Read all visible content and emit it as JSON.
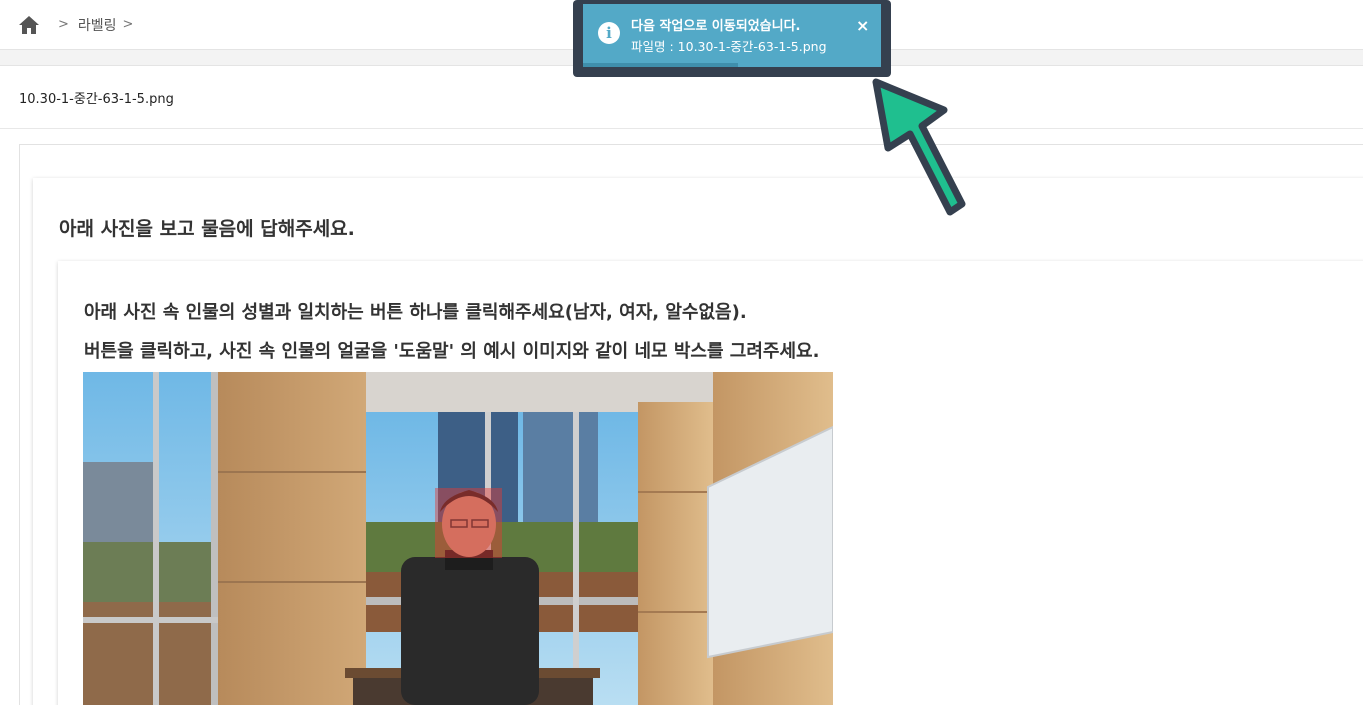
{
  "breadcrumb": {
    "home_icon": "home-icon",
    "separator": ">",
    "item": "라벨링",
    "trailing_separator": ">"
  },
  "file": {
    "name": "10.30-1-중간-63-1-5.png"
  },
  "question": {
    "title": "아래 사진을 보고 물음에 답해주세요.",
    "instruction_1": "아래 사진 속 인물의 성별과 일치하는 버튼 하나를 클릭해주세요(남자, 여자, 알수없음).",
    "instruction_2": "버튼을 클릭하고, 사진 속 인물의 얼굴을 '도움말' 의 예시 이미지와 같이 네모 박스를 그려주세요."
  },
  "toast": {
    "title": "다음 작업으로 이동되었습니다.",
    "message": "파일명 : 10.30-1-중간-63-1-5.png",
    "close_label": "×",
    "info_label": "i",
    "progress": 0.52,
    "color": "#53a9c7",
    "frame_color": "#35404f"
  },
  "annotation_arrow": {
    "color": "#1fbf8f"
  },
  "photo": {
    "face_box_color": "#e53935"
  }
}
